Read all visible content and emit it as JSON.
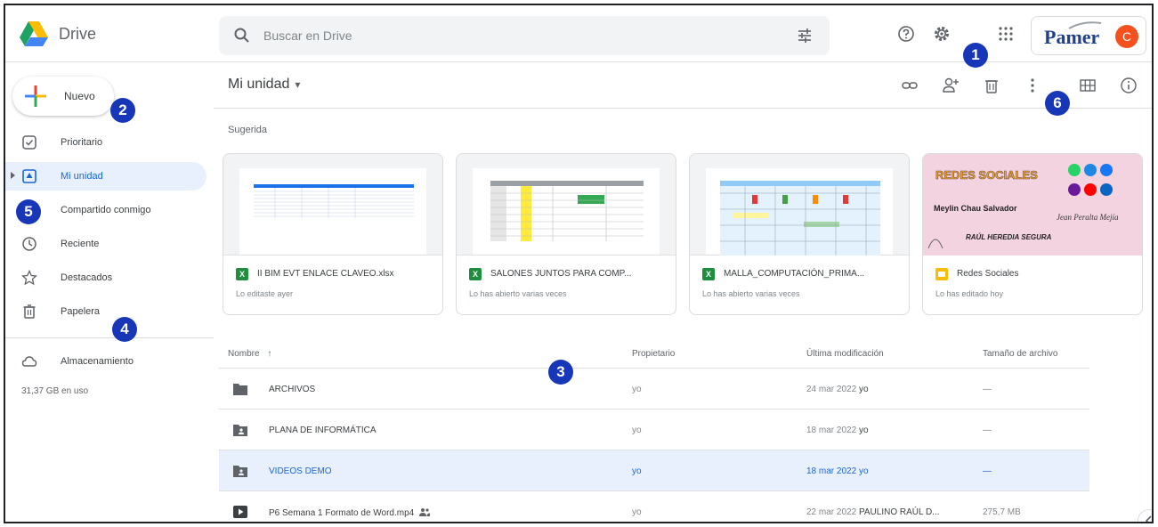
{
  "header": {
    "app_name": "Drive",
    "search_placeholder": "Buscar en Drive",
    "brand": "Pamer",
    "avatar_initial": "C"
  },
  "badges": [
    "1",
    "2",
    "3",
    "4",
    "5",
    "6"
  ],
  "sidebar": {
    "new_label": "Nuevo",
    "items": [
      {
        "label": "Prioritario",
        "icon": "check-square-icon"
      },
      {
        "label": "Mi unidad",
        "icon": "my-drive-icon"
      },
      {
        "label": "Compartido conmigo",
        "icon": "shared-icon"
      },
      {
        "label": "Reciente",
        "icon": "clock-icon"
      },
      {
        "label": "Destacados",
        "icon": "star-icon"
      },
      {
        "label": "Papelera",
        "icon": "trash-icon"
      },
      {
        "label": "Almacenamiento",
        "icon": "cloud-icon"
      }
    ],
    "storage_used": "31,37 GB en uso"
  },
  "main": {
    "title": "Mi unidad",
    "suggested_label": "Sugerida",
    "cards": [
      {
        "name": "II BIM EVT ENLACE CLAVEO.xlsx",
        "sub": "Lo editaste ayer",
        "type": "xls",
        "type_label": "X"
      },
      {
        "name": "SALONES JUNTOS PARA COMP...",
        "sub": "Lo has abierto varias veces",
        "type": "xls",
        "type_label": "X"
      },
      {
        "name": "MALLA_COMPUTACIÓN_PRIMA...",
        "sub": "Lo has abierto varias veces",
        "type": "xls",
        "type_label": "X"
      },
      {
        "name": "Redes Sociales",
        "sub": "Lo has editado hoy",
        "type": "slides",
        "type_label": ""
      }
    ],
    "poster": {
      "title": "REDES SOCIALES",
      "name1": "Meylin Chau Salvador",
      "name2": "Jean Peralta Mejía",
      "name3": "RAÚL HEREDIA SEGURA"
    },
    "table": {
      "headers": {
        "name": "Nombre",
        "sort_arrow": "↑",
        "owner": "Propietario",
        "modified": "Última modificación",
        "size": "Tamaño de archivo"
      },
      "rows": [
        {
          "name": "ARCHIVOS",
          "kind": "folder",
          "owner": "yo",
          "date": "24 mar 2022",
          "by": "yo",
          "size": "—"
        },
        {
          "name": "PLANA DE INFORMÁTICA",
          "kind": "shared-folder",
          "owner": "yo",
          "date": "18 mar 2022",
          "by": "yo",
          "size": "—"
        },
        {
          "name": "VIDEOS DEMO",
          "kind": "shared-folder",
          "owner": "yo",
          "date": "18 mar 2022",
          "by": "yo",
          "size": "—"
        },
        {
          "name": "P6 Semana 1 Formato de Word.mp4",
          "kind": "video",
          "owner": "yo",
          "date": "22 mar 2022",
          "by": "PAULINO RAÚL D...",
          "size": "275,7 MB"
        }
      ]
    }
  },
  "colors": {
    "accent": "#1967d2",
    "selected_bg": "#e8f0fe",
    "badge": "#1736b8",
    "sheets_green": "#1e8e3e",
    "slides_yellow": "#fbbc04",
    "avatar": "#f4511e"
  }
}
